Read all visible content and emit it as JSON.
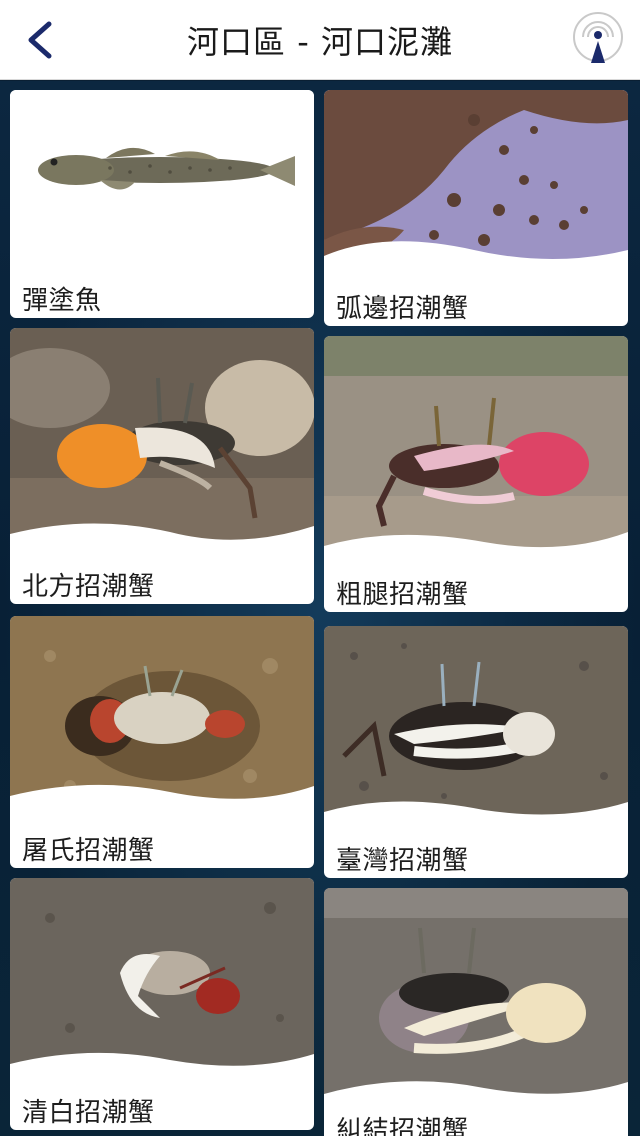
{
  "header": {
    "title": "河口區 - 河口泥灘",
    "back_icon": "chevron-left-icon",
    "beacon_icon": "beacon-location-icon",
    "accent": "#1b2a6b"
  },
  "species": [
    {
      "name": "彈塗魚",
      "photo": "mudskipper"
    },
    {
      "name": "弧邊招潮蟹",
      "photo": "crab-mudflat"
    },
    {
      "name": "北方招潮蟹",
      "photo": "crab-orange-claw"
    },
    {
      "name": "粗腿招潮蟹",
      "photo": "crab-pink-claw"
    },
    {
      "name": "屠氏招潮蟹",
      "photo": "crab-white-claw-sand"
    },
    {
      "name": "臺灣招潮蟹",
      "photo": "crab-white-claw-dark"
    },
    {
      "name": "清白招潮蟹",
      "photo": "crab-white-small"
    },
    {
      "name": "糾結招潮蟹",
      "photo": "crab-cream-claw"
    }
  ]
}
